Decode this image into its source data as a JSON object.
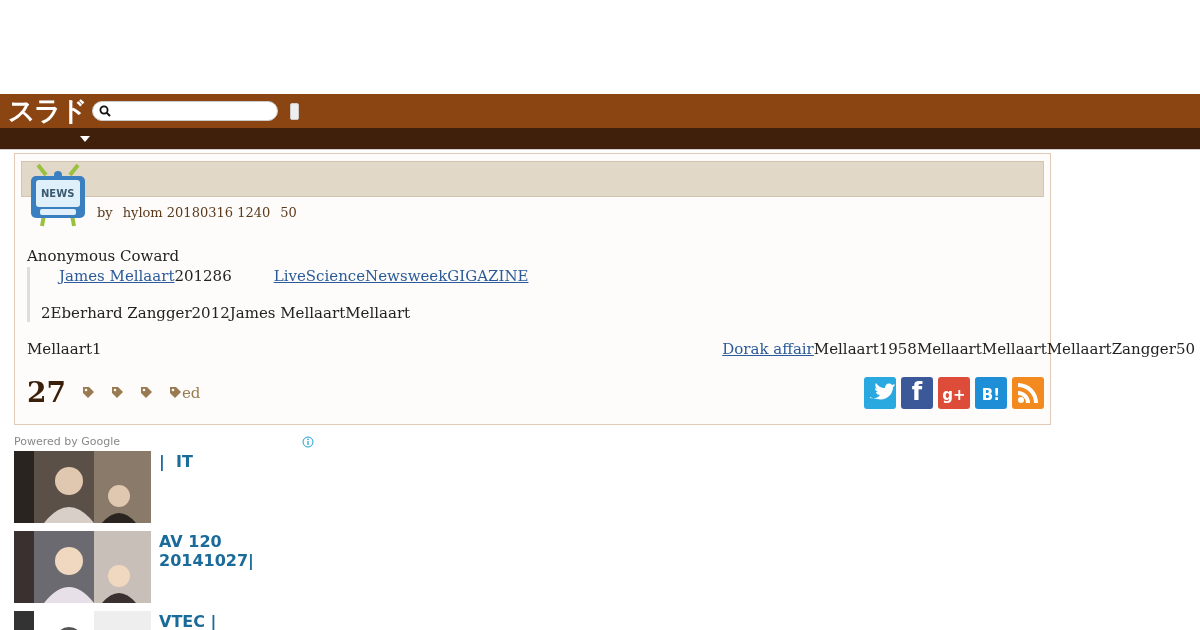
{
  "header": {
    "logo": "スラド"
  },
  "article": {
    "icon_label": "NEWS",
    "byline": [
      {
        "text": "by"
      },
      {
        "text": "hylom 20180316 1240"
      },
      {
        "text": "50"
      }
    ],
    "author": "Anonymous Coward",
    "quote": [
      [
        {
          "kind": "link",
          "text": "James Mellaart"
        },
        {
          "kind": "text",
          "text": "201286"
        },
        {
          "kind": "link",
          "text": "LiveScienceNewsweekGIGAZINE"
        }
      ],
      [
        {
          "kind": "text",
          "text": "2Eberhard Zangger2012James MellaartMellaart"
        }
      ]
    ],
    "body_left": "Mellaart1",
    "body_right": [
      {
        "kind": "link",
        "text": "Dorak affair"
      },
      {
        "kind": "text",
        "text": "Mellaart1958MellaartMellaartMellaartZangger50"
      }
    ],
    "comments": "27",
    "tags": [
      {
        "kind": "bare"
      },
      {
        "kind": "bare"
      },
      {
        "kind": "bare"
      },
      {
        "kind": "labeled",
        "label": "ed"
      }
    ],
    "share": [
      {
        "kind": "twitter"
      },
      {
        "kind": "facebook",
        "glyph": "f"
      },
      {
        "kind": "googleplus",
        "glyph": "g+"
      },
      {
        "kind": "hatena",
        "glyph": "B!"
      },
      {
        "kind": "rss"
      }
    ]
  },
  "ad": {
    "powered": "Powered by Google",
    "items": [
      {
        "title": "|  IT",
        "kind": "picture"
      },
      {
        "title": "AV 120 20141027|",
        "kind": "picture"
      },
      {
        "title": "VTEC |",
        "kind": "picture"
      }
    ]
  }
}
